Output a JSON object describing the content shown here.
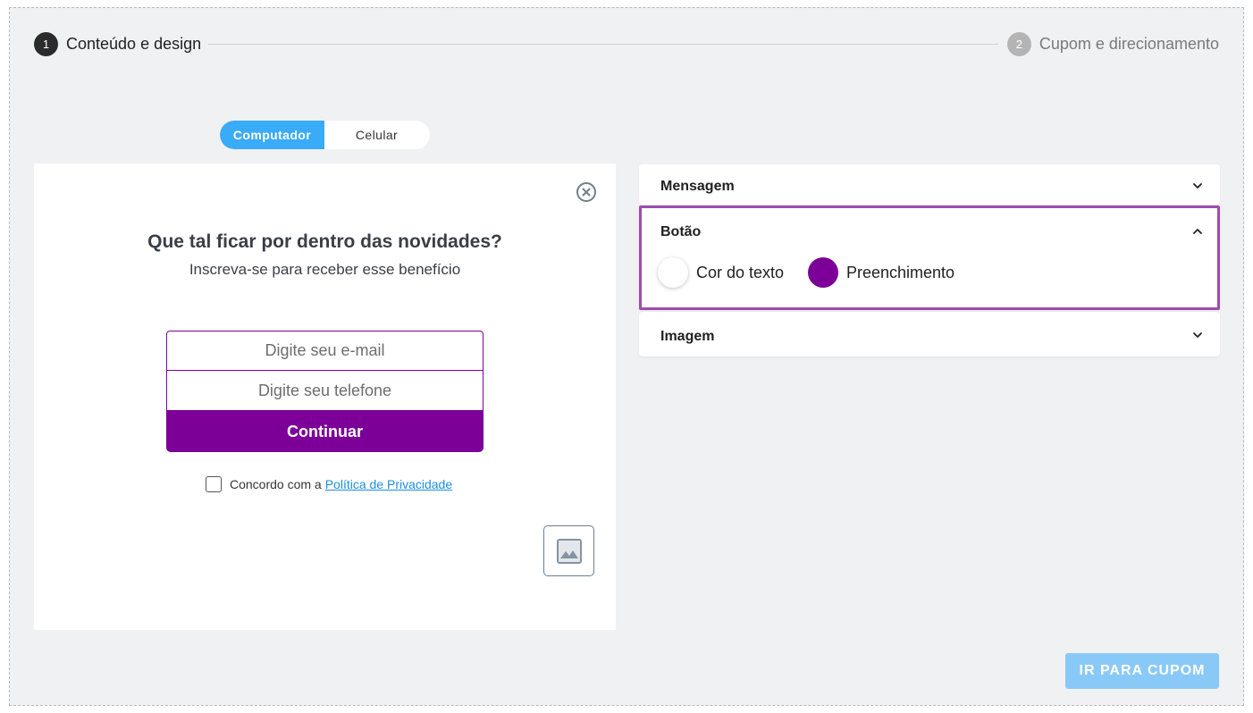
{
  "stepper": {
    "step1": {
      "number": "1",
      "label": "Conteúdo e design"
    },
    "step2": {
      "number": "2",
      "label": "Cupom e direcionamento"
    }
  },
  "device_toggle": {
    "desktop": "Computador",
    "mobile": "Celular",
    "selected": "Computador"
  },
  "preview": {
    "title": "Que tal ficar por dentro das novidades?",
    "subtitle": "Inscreva-se para receber esse benefício",
    "email_placeholder": "Digite seu e-mail",
    "phone_placeholder": "Digite seu telefone",
    "submit_label": "Continuar",
    "consent_text": "Concordo com a",
    "consent_link": "Política de Privacidade"
  },
  "accordions": {
    "message": {
      "title": "Mensagem",
      "expanded": false
    },
    "button": {
      "title": "Botão",
      "expanded": true,
      "text_color_label": "Cor do texto",
      "text_color": "#ffffff",
      "fill_label": "Preenchimento",
      "fill_color": "#7c0098"
    },
    "image": {
      "title": "Imagem",
      "expanded": false
    }
  },
  "cta": {
    "label": "IR PARA CUPOM"
  },
  "colors": {
    "accent_blue": "#3aabf6",
    "brand_purple": "#7c0098",
    "highlight_border": "#9f4cb0"
  }
}
